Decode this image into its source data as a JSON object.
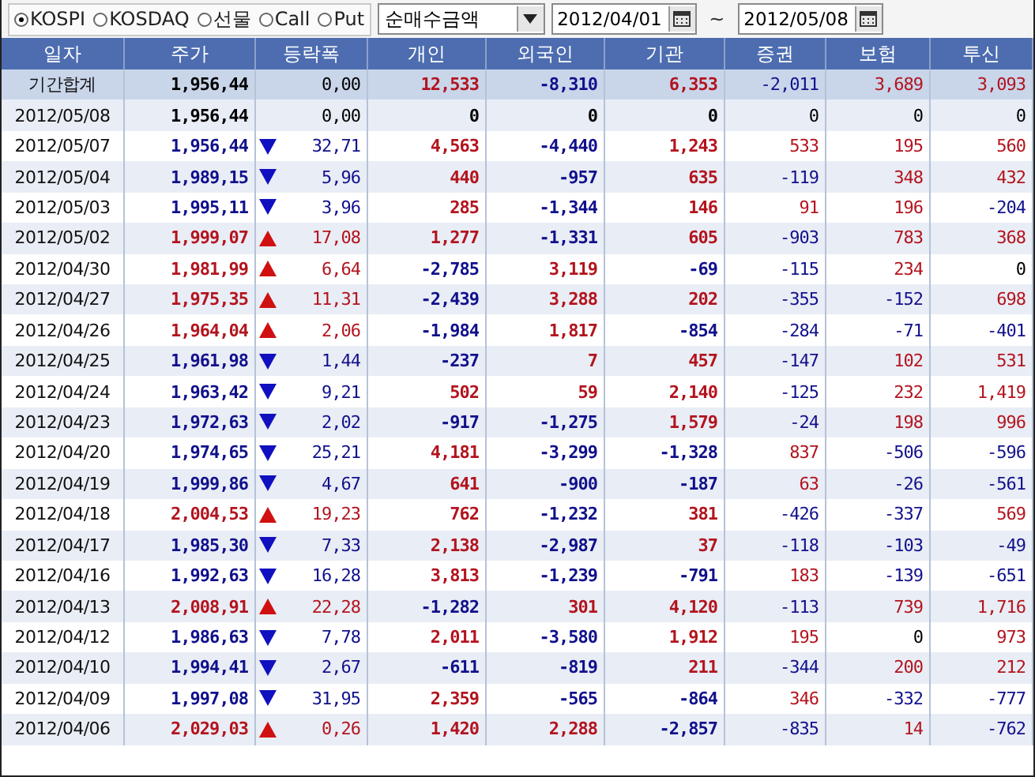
{
  "toolbar": {
    "markets": [
      {
        "label": "KOSPI",
        "selected": true
      },
      {
        "label": "KOSDAQ",
        "selected": false
      },
      {
        "label": "선물",
        "selected": false
      },
      {
        "label": "Call",
        "selected": false
      },
      {
        "label": "Put",
        "selected": false
      }
    ],
    "measure": "순매수금액",
    "date_from": "2012/04/01",
    "separator": "~",
    "date_to": "2012/05/08"
  },
  "table": {
    "columns": [
      "일자",
      "주가",
      "등락폭",
      "개인",
      "외국인",
      "기관",
      "증권",
      "보험",
      "투신"
    ],
    "summary": {
      "date": "기간합계",
      "price": "1,956,44",
      "change": "0,00",
      "values": [
        "12,533",
        "-8,310",
        "6,353",
        "-2,011",
        "3,689",
        "3,093"
      ]
    },
    "rows": [
      {
        "date": "2012/05/08",
        "price": "1,956,44",
        "kind": "flat",
        "change": "0,00",
        "values": [
          "0",
          "0",
          "0",
          "0",
          "0",
          "0"
        ]
      },
      {
        "date": "2012/05/07",
        "price": "1,956,44",
        "kind": "down",
        "change": "32,71",
        "values": [
          "4,563",
          "-4,440",
          "1,243",
          "533",
          "195",
          "560"
        ]
      },
      {
        "date": "2012/05/04",
        "price": "1,989,15",
        "kind": "down",
        "change": "5,96",
        "values": [
          "440",
          "-957",
          "635",
          "-119",
          "348",
          "432"
        ]
      },
      {
        "date": "2012/05/03",
        "price": "1,995,11",
        "kind": "down",
        "change": "3,96",
        "values": [
          "285",
          "-1,344",
          "146",
          "91",
          "196",
          "-204"
        ]
      },
      {
        "date": "2012/05/02",
        "price": "1,999,07",
        "kind": "up",
        "change": "17,08",
        "values": [
          "1,277",
          "-1,331",
          "605",
          "-903",
          "783",
          "368"
        ]
      },
      {
        "date": "2012/04/30",
        "price": "1,981,99",
        "kind": "up",
        "change": "6,64",
        "values": [
          "-2,785",
          "3,119",
          "-69",
          "-115",
          "234",
          "0"
        ]
      },
      {
        "date": "2012/04/27",
        "price": "1,975,35",
        "kind": "up",
        "change": "11,31",
        "values": [
          "-2,439",
          "3,288",
          "202",
          "-355",
          "-152",
          "698"
        ]
      },
      {
        "date": "2012/04/26",
        "price": "1,964,04",
        "kind": "up",
        "change": "2,06",
        "values": [
          "-1,984",
          "1,817",
          "-854",
          "-284",
          "-71",
          "-401"
        ]
      },
      {
        "date": "2012/04/25",
        "price": "1,961,98",
        "kind": "down",
        "change": "1,44",
        "values": [
          "-237",
          "7",
          "457",
          "-147",
          "102",
          "531"
        ]
      },
      {
        "date": "2012/04/24",
        "price": "1,963,42",
        "kind": "down",
        "change": "9,21",
        "values": [
          "502",
          "59",
          "2,140",
          "-125",
          "232",
          "1,419"
        ]
      },
      {
        "date": "2012/04/23",
        "price": "1,972,63",
        "kind": "down",
        "change": "2,02",
        "values": [
          "-917",
          "-1,275",
          "1,579",
          "-24",
          "198",
          "996"
        ]
      },
      {
        "date": "2012/04/20",
        "price": "1,974,65",
        "kind": "down",
        "change": "25,21",
        "values": [
          "4,181",
          "-3,299",
          "-1,328",
          "837",
          "-506",
          "-596"
        ]
      },
      {
        "date": "2012/04/19",
        "price": "1,999,86",
        "kind": "down",
        "change": "4,67",
        "values": [
          "641",
          "-900",
          "-187",
          "63",
          "-26",
          "-561"
        ]
      },
      {
        "date": "2012/04/18",
        "price": "2,004,53",
        "kind": "up",
        "change": "19,23",
        "values": [
          "762",
          "-1,232",
          "381",
          "-426",
          "-337",
          "569"
        ]
      },
      {
        "date": "2012/04/17",
        "price": "1,985,30",
        "kind": "down",
        "change": "7,33",
        "values": [
          "2,138",
          "-2,987",
          "37",
          "-118",
          "-103",
          "-49"
        ]
      },
      {
        "date": "2012/04/16",
        "price": "1,992,63",
        "kind": "down",
        "change": "16,28",
        "values": [
          "3,813",
          "-1,239",
          "-791",
          "183",
          "-139",
          "-651"
        ]
      },
      {
        "date": "2012/04/13",
        "price": "2,008,91",
        "kind": "up",
        "change": "22,28",
        "values": [
          "-1,282",
          "301",
          "4,120",
          "-113",
          "739",
          "1,716"
        ]
      },
      {
        "date": "2012/04/12",
        "price": "1,986,63",
        "kind": "down",
        "change": "7,78",
        "values": [
          "2,011",
          "-3,580",
          "1,912",
          "195",
          "0",
          "973"
        ]
      },
      {
        "date": "2012/04/10",
        "price": "1,994,41",
        "kind": "down",
        "change": "2,67",
        "values": [
          "-611",
          "-819",
          "211",
          "-344",
          "200",
          "212"
        ]
      },
      {
        "date": "2012/04/09",
        "price": "1,997,08",
        "kind": "down",
        "change": "31,95",
        "values": [
          "2,359",
          "-565",
          "-864",
          "346",
          "-332",
          "-777"
        ]
      },
      {
        "date": "2012/04/06",
        "price": "2,029,03",
        "kind": "up",
        "change": "0,26",
        "values": [
          "1,420",
          "2,288",
          "-2,857",
          "-835",
          "14",
          "-762"
        ]
      }
    ]
  }
}
